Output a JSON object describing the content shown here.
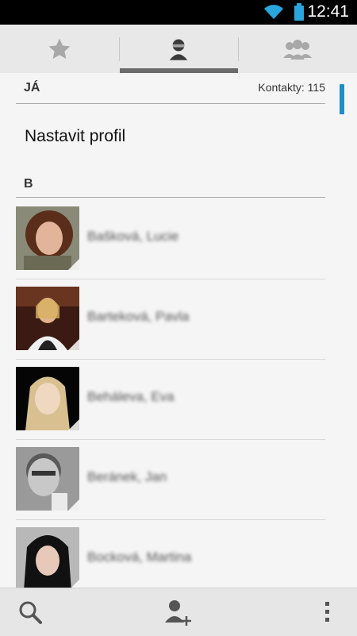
{
  "status_bar": {
    "time": "12:41",
    "icons": [
      "wifi-icon",
      "battery-icon"
    ]
  },
  "tabs": [
    {
      "icon": "star-icon",
      "selected": false
    },
    {
      "icon": "person-icon",
      "selected": true
    },
    {
      "icon": "group-icon",
      "selected": false
    }
  ],
  "me_section": {
    "header": "JÁ",
    "contact_count": "Kontakty: 115",
    "setup_profile": "Nastavit profil"
  },
  "section_letter": "B",
  "contacts": [
    {
      "name": "Bašková, Lucie"
    },
    {
      "name": "Barteková, Pavla"
    },
    {
      "name": "Beháleva, Eva"
    },
    {
      "name": "Beránek, Jan"
    },
    {
      "name": "Bocková, Martina"
    }
  ],
  "bottom_bar": {
    "icons": [
      "search-icon",
      "add-contact-icon",
      "overflow-menu-icon"
    ]
  },
  "colors": {
    "accent": "#1f8fc8",
    "tab_indicator": "#6b6b6b",
    "background": "#f5f5f5"
  }
}
